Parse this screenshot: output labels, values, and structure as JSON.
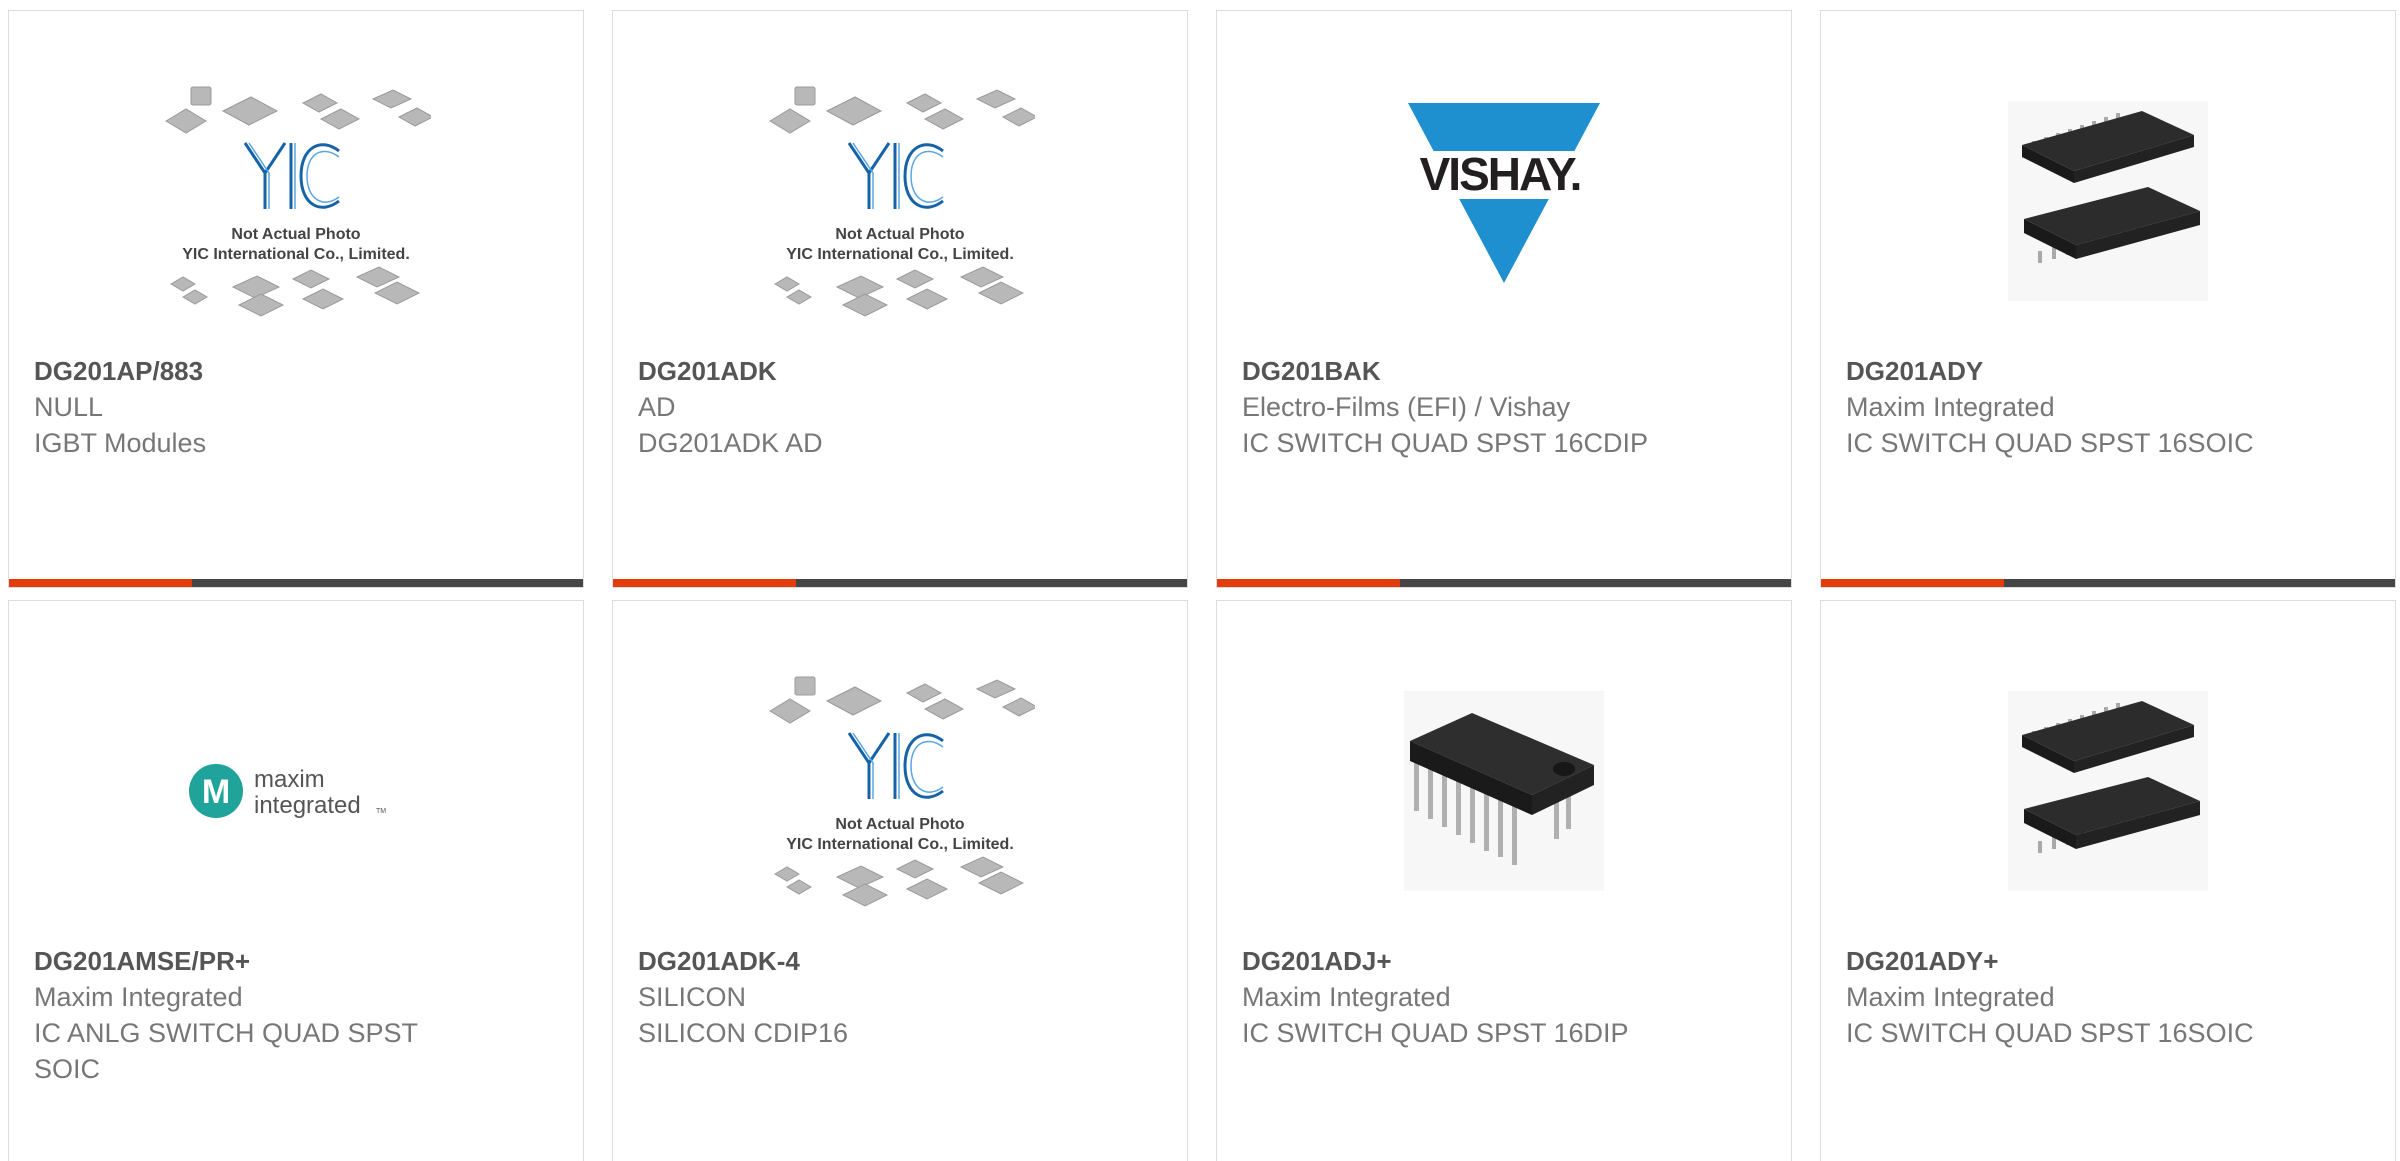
{
  "colors": {
    "accent": "#e23c0c",
    "bar": "#454545",
    "part_number": "#555555",
    "text": "#777777",
    "vishay_blue": "#1e90d0",
    "maxim_teal": "#1fa39b"
  },
  "products": [
    {
      "part_number": "DG201AP/883",
      "manufacturer": "NULL",
      "description": "IGBT Modules",
      "image": "yic-placeholder-image"
    },
    {
      "part_number": "DG201ADK",
      "manufacturer": "AD",
      "description": "DG201ADK AD",
      "image": "yic-placeholder-image"
    },
    {
      "part_number": "DG201BAK",
      "manufacturer": "Electro-Films (EFI) / Vishay",
      "description": "IC SWITCH QUAD SPST 16CDIP",
      "image": "vishay-logo"
    },
    {
      "part_number": "DG201ADY",
      "manufacturer": "Maxim Integrated",
      "description": "IC SWITCH QUAD SPST 16SOIC",
      "image": "soic-chip-photo"
    },
    {
      "part_number": "DG201AMSE/PR+",
      "manufacturer": "Maxim Integrated",
      "description": "IC ANLG SWITCH QUAD SPST SOIC",
      "image": "maxim-integrated-logo"
    },
    {
      "part_number": "DG201ADK-4",
      "manufacturer": "SILICON",
      "description": "SILICON CDIP16",
      "image": "yic-placeholder-image"
    },
    {
      "part_number": "DG201ADJ+",
      "manufacturer": "Maxim Integrated",
      "description": "IC SWITCH QUAD SPST 16DIP",
      "image": "dip-chip-photo"
    },
    {
      "part_number": "DG201ADY+",
      "manufacturer": "Maxim Integrated",
      "description": "IC SWITCH QUAD SPST 16SOIC",
      "image": "soic-chip-photo"
    }
  ],
  "placeholder": {
    "logo_text": "YIC",
    "line1": "Not Actual Photo",
    "line2": "YIC International Co., Limited."
  },
  "vishay": {
    "logo_text": "VISHAY."
  },
  "maxim": {
    "logo_line1": "maxim",
    "logo_line2": "integrated",
    "tm": "TM"
  }
}
